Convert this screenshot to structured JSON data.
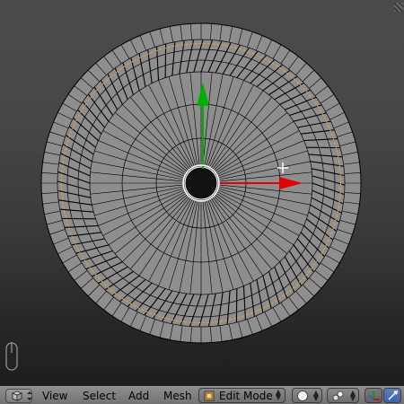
{
  "header": {
    "menus": [
      "View",
      "Select",
      "Add",
      "Mesh"
    ],
    "mode": "Edit Mode"
  },
  "viewport": {
    "icons": {
      "manipulator_x": "red-arrow",
      "manipulator_y": "green-arrow",
      "cursor": "crosshair-move",
      "mouse_hint": "mouse-icon"
    },
    "colors": {
      "mesh_fill": "#8e8e8e",
      "edge": "#000000",
      "seam": "#e8a030",
      "x_axis": "#e00000",
      "y_axis": "#00b000"
    }
  }
}
